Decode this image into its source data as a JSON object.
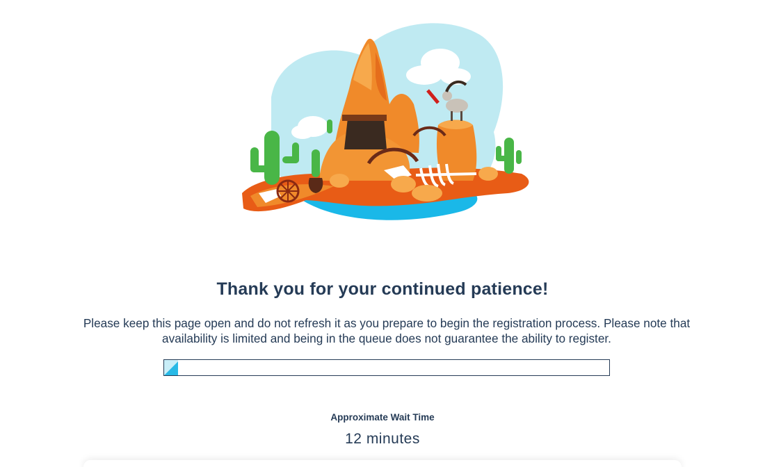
{
  "illustration": {
    "icon": "big-thunder-mountain-illustration"
  },
  "title": "Thank you for your continued patience!",
  "notice": "Please keep this page open and do not refresh it as you prepare to begin the registration process. Please note that availability is limited and being in the queue does not guarantee the ability to register.",
  "progress": {
    "fraction": 0.032,
    "accent": "#28b9e6"
  },
  "wait": {
    "label": "Approximate Wait Time",
    "value": "12 minutes"
  },
  "colors": {
    "text": "#253b56",
    "sky": "#bfeaf2",
    "water": "#1ab8e8",
    "rock": "#f08a2a"
  }
}
